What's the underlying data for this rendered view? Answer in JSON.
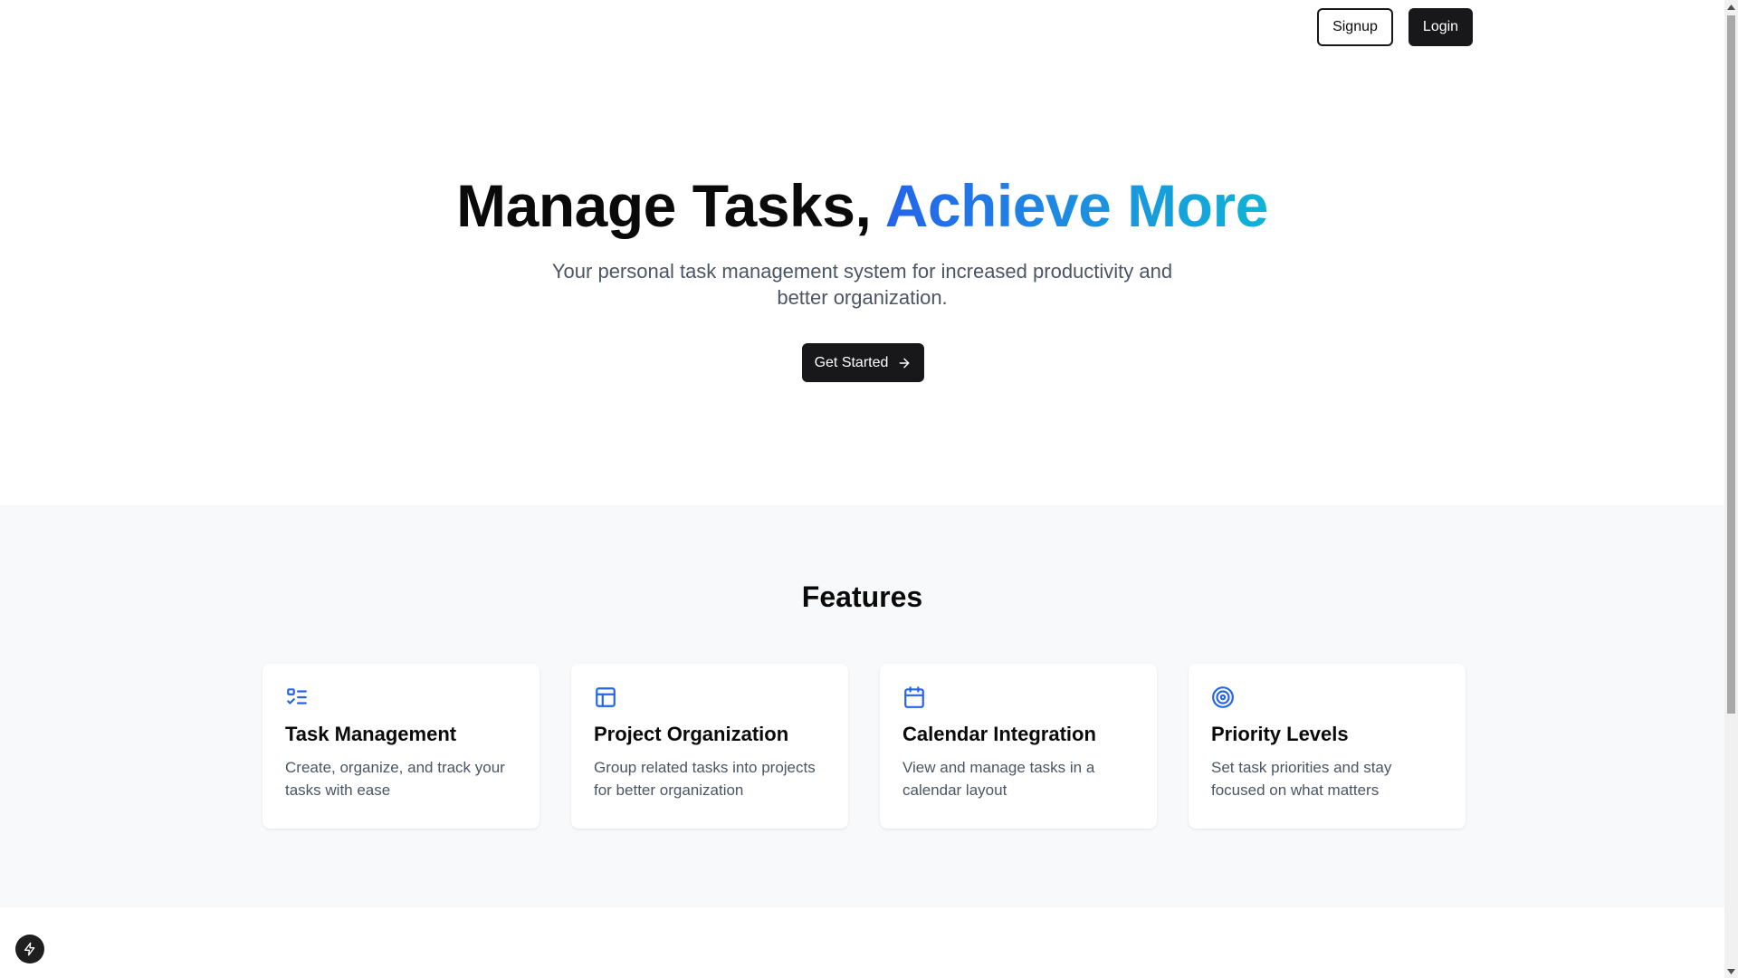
{
  "header": {
    "signup_label": "Signup",
    "login_label": "Login"
  },
  "hero": {
    "title_plain": "Manage Tasks,",
    "title_accent": "Achieve More",
    "subtitle_line1": "Your personal task management system for increased productivity and",
    "subtitle_line2": "better organization.",
    "cta_label": "Get Started",
    "cta_icon": "arrow-right-icon"
  },
  "features": {
    "title": "Features",
    "items": [
      {
        "icon": "list-checks-icon",
        "title": "Task Management",
        "description": "Create, organize, and track your tasks with ease"
      },
      {
        "icon": "layout-panel-icon",
        "title": "Project Organization",
        "description": "Group related tasks into projects for better organization"
      },
      {
        "icon": "calendar-icon",
        "title": "Calendar Integration",
        "description": "View and manage tasks in a calendar layout"
      },
      {
        "icon": "target-icon",
        "title": "Priority Levels",
        "description": "Set task priorities and stay focused on what matters"
      }
    ]
  },
  "floating_badge": {
    "icon": "bolt-icon"
  },
  "colors": {
    "accent_blue": "#2563eb",
    "accent_cyan": "#0fb3d6",
    "primary_dark": "#18181b",
    "muted_text": "#4b5563",
    "section_bg": "#f8f9fa"
  }
}
